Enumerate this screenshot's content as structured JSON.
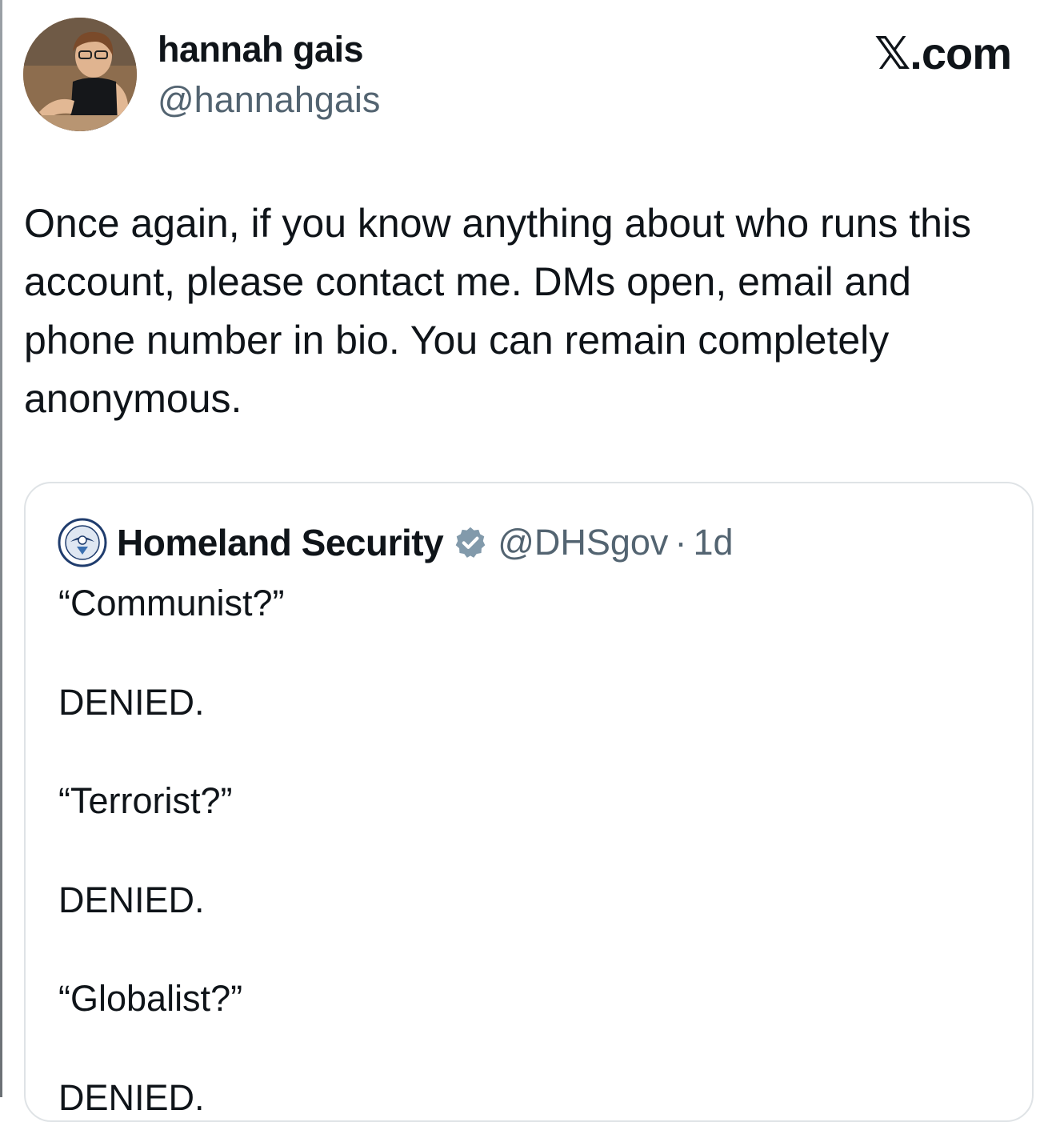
{
  "brand": "𝕏.com",
  "author": {
    "name": "hannah gais",
    "handle": "@hannahgais"
  },
  "tweet": {
    "text": "Once again, if you know anything about who runs this account, please contact me. DMs open, email and phone number in bio. You can remain completely anonymous."
  },
  "quoted": {
    "name": "Homeland Security",
    "handle": "@DHSgov",
    "time": "1d",
    "separator": "·",
    "lines": [
      "“Communist?”",
      "DENIED.",
      "“Terrorist?”",
      "DENIED.",
      "“Globalist?”",
      "DENIED."
    ]
  },
  "colors": {
    "text": "#0f1419",
    "secondary": "#536471",
    "verified": "#829aab",
    "border": "#dfe3e6"
  }
}
